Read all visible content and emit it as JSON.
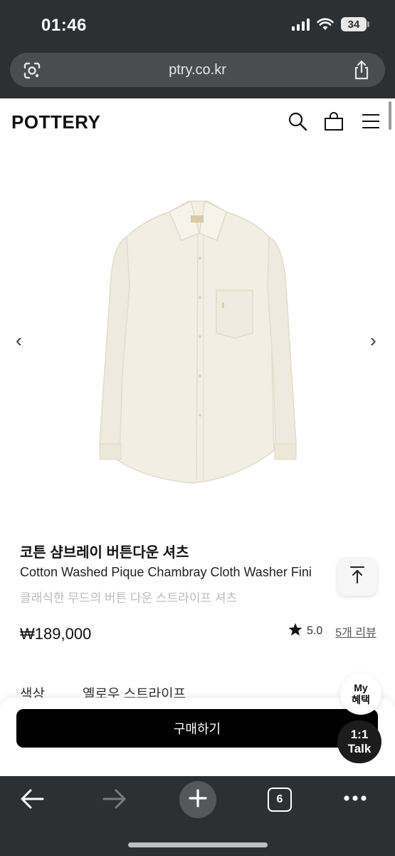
{
  "status_bar": {
    "time": "01:46",
    "battery": "34"
  },
  "browser": {
    "url": "ptry.co.kr",
    "tab_count": "6"
  },
  "site": {
    "logo": "POTTERY"
  },
  "carousel": {
    "prev": "‹",
    "next": "›"
  },
  "product": {
    "title_ko": "코튼 샴브레이 버튼다운 셔츠",
    "title_en": "Cotton Washed Pique Chambray Cloth Washer Fini",
    "description": "클래식한 무드의 버튼 다운 스트라이프 셔츠",
    "price": "₩189,000",
    "rating": "5.0",
    "reviews": "5개 리뷰",
    "color_label": "색상",
    "color_value": "옐로우 스트라이프"
  },
  "actions": {
    "buy": "구매하기"
  },
  "floating": {
    "my_line1": "My",
    "my_line2": "혜택",
    "talk_line1": "1:1",
    "talk_line2": "Talk"
  },
  "icons": {
    "search": "search-icon",
    "bag": "bag-icon",
    "menu": "menu-icon",
    "lens": "google-lens-icon",
    "share": "share-icon",
    "star": "star-icon",
    "back": "back-arrow-icon",
    "forward": "forward-arrow-icon",
    "plus": "plus-icon",
    "more": "more-icon"
  },
  "colors": {
    "chrome": "#2d2f31",
    "buy_button": "#000000",
    "shirt": "#f2eee2"
  }
}
